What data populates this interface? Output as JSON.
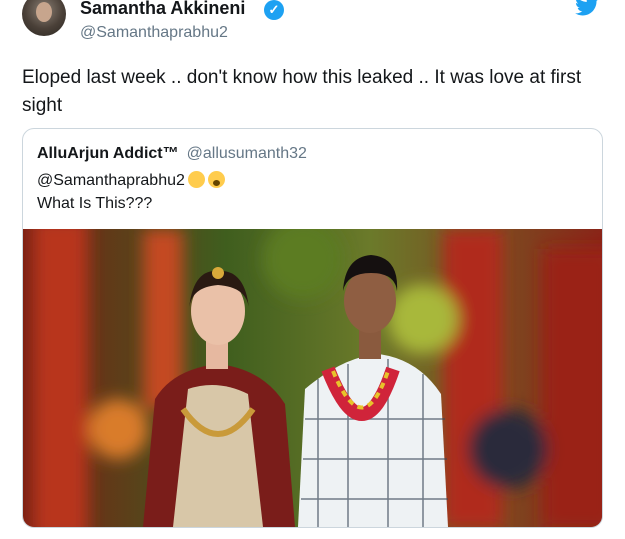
{
  "tweet": {
    "author_name": "Samantha Akkineni",
    "author_handle": "@Samanthaprabhu2",
    "text": "Eloped last week .. don't know how this leaked .. It was love at first sight"
  },
  "quoted_tweet": {
    "author_name": "AlluArjun Addict™",
    "author_handle": "@allusumanth32",
    "mention": "@Samanthaprabhu2",
    "text": "What Is This???",
    "emojis": [
      "anxious-face-emoji",
      "screaming-face-emoji"
    ]
  },
  "colors": {
    "twitter_blue": "#1da1f2",
    "text": "#14171a",
    "secondary_text": "#657786",
    "border": "#ccd6dd"
  }
}
